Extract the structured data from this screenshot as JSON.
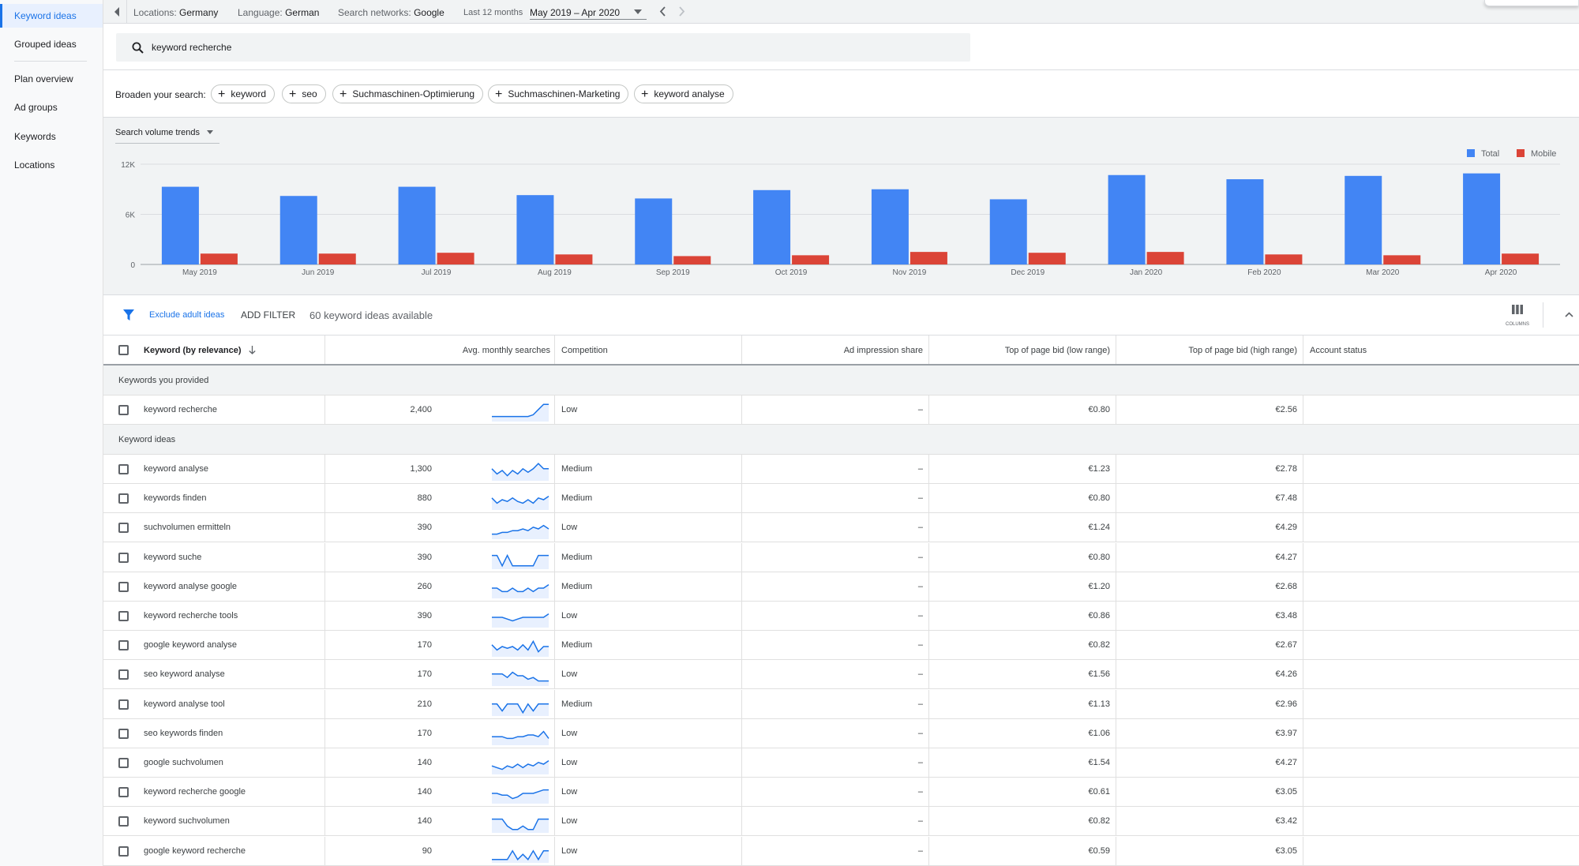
{
  "sidebar": {
    "items": [
      {
        "label": "Keyword ideas",
        "active": true
      },
      {
        "label": "Grouped ideas"
      },
      {
        "label": "Plan overview"
      },
      {
        "label": "Ad groups"
      },
      {
        "label": "Keywords"
      },
      {
        "label": "Locations"
      }
    ]
  },
  "topbar": {
    "locations_label": "Locations:",
    "locations_value": "Germany",
    "language_label": "Language:",
    "language_value": "German",
    "networks_label": "Search networks:",
    "networks_value": "Google",
    "range_label": "Last 12 months",
    "range_value": "May 2019 – Apr 2020"
  },
  "search": {
    "value": "keyword recherche"
  },
  "broaden": {
    "label": "Broaden your search:",
    "chips": [
      "keyword",
      "seo",
      "Suchmaschinen-Optimierung",
      "Suchmaschinen-Marketing",
      "keyword analyse"
    ]
  },
  "trends": {
    "selector_label": "Search volume trends"
  },
  "chart_data": {
    "type": "bar",
    "categories": [
      "May 2019",
      "Jun 2019",
      "Jul 2019",
      "Aug 2019",
      "Sep 2019",
      "Oct 2019",
      "Nov 2019",
      "Dec 2019",
      "Jan 2020",
      "Feb 2020",
      "Mar 2020",
      "Apr 2020"
    ],
    "series": [
      {
        "name": "Total",
        "color": "#4285f4",
        "values": [
          9300,
          8200,
          9300,
          8300,
          7900,
          8900,
          9000,
          7800,
          10700,
          10200,
          10600,
          10900
        ]
      },
      {
        "name": "Mobile",
        "color": "#db4437",
        "values": [
          1300,
          1300,
          1400,
          1200,
          1000,
          1100,
          1500,
          1400,
          1500,
          1200,
          1100,
          1300
        ]
      }
    ],
    "yticks": [
      "12K",
      "6K",
      "0"
    ],
    "ylim": [
      0,
      12000
    ],
    "legend": "top-right"
  },
  "filterbar": {
    "exclude_label": "Exclude adult ideas",
    "add_filter_label": "ADD FILTER",
    "count_label": "60 keyword ideas available",
    "columns_label": "COLUMNS"
  },
  "table": {
    "headers": {
      "keyword": "Keyword (by relevance)",
      "searches": "Avg. monthly searches",
      "competition": "Competition",
      "impression": "Ad impression share",
      "bid_low": "Top of page bid (low range)",
      "bid_high": "Top of page bid (high range)",
      "status": "Account status"
    },
    "group_provided": "Keywords you provided",
    "group_ideas": "Keyword ideas",
    "provided": [
      {
        "keyword": "keyword recherche",
        "searches": "2,400",
        "competition": "Low",
        "impression": "–",
        "bid_low": "€0.80",
        "bid_high": "€2.56",
        "trend": [
          2,
          2,
          2,
          2,
          2,
          2,
          2,
          2,
          3,
          6,
          9,
          9
        ]
      }
    ],
    "ideas": [
      {
        "keyword": "keyword analyse",
        "searches": "1,300",
        "competition": "Medium",
        "impression": "–",
        "bid_low": "€1.23",
        "bid_high": "€2.78",
        "trend": [
          6,
          3,
          5,
          2,
          5,
          3,
          6,
          4,
          6,
          9,
          6,
          6
        ]
      },
      {
        "keyword": "keywords finden",
        "searches": "880",
        "competition": "Medium",
        "impression": "–",
        "bid_low": "€0.80",
        "bid_high": "€7.48",
        "trend": [
          6,
          3,
          5,
          4,
          6,
          4,
          3,
          5,
          3,
          6,
          5,
          7
        ]
      },
      {
        "keyword": "suchvolumen ermitteln",
        "searches": "390",
        "competition": "Low",
        "impression": "–",
        "bid_low": "€1.24",
        "bid_high": "€4.29",
        "trend": [
          2,
          2,
          3,
          3,
          4,
          4,
          5,
          4,
          6,
          5,
          7,
          5
        ]
      },
      {
        "keyword": "keyword suche",
        "searches": "390",
        "competition": "Medium",
        "impression": "–",
        "bid_low": "€0.80",
        "bid_high": "€4.27",
        "trend": [
          7,
          7,
          1,
          7,
          1,
          1,
          1,
          1,
          1,
          7,
          7,
          7
        ]
      },
      {
        "keyword": "keyword analyse google",
        "searches": "260",
        "competition": "Medium",
        "impression": "–",
        "bid_low": "€1.20",
        "bid_high": "€2.68",
        "trend": [
          5,
          5,
          3,
          3,
          5,
          3,
          3,
          5,
          3,
          5,
          5,
          7
        ]
      },
      {
        "keyword": "keyword recherche tools",
        "searches": "390",
        "competition": "Low",
        "impression": "–",
        "bid_low": "€0.86",
        "bid_high": "€3.48",
        "trend": [
          5,
          5,
          5,
          4,
          3,
          4,
          5,
          5,
          5,
          5,
          5,
          7
        ]
      },
      {
        "keyword": "google keyword analyse",
        "searches": "170",
        "competition": "Medium",
        "impression": "–",
        "bid_low": "€0.82",
        "bid_high": "€2.67",
        "trend": [
          6,
          3,
          5,
          4,
          5,
          3,
          6,
          3,
          8,
          2,
          5,
          5
        ]
      },
      {
        "keyword": "seo keyword analyse",
        "searches": "170",
        "competition": "Low",
        "impression": "–",
        "bid_low": "€1.56",
        "bid_high": "€4.26",
        "trend": [
          6,
          6,
          6,
          4,
          7,
          5,
          5,
          3,
          4,
          2,
          2,
          2
        ]
      },
      {
        "keyword": "keyword analyse tool",
        "searches": "210",
        "competition": "Medium",
        "impression": "–",
        "bid_low": "€1.13",
        "bid_high": "€2.96",
        "trend": [
          6,
          6,
          2,
          6,
          6,
          6,
          1,
          6,
          2,
          6,
          6,
          6
        ]
      },
      {
        "keyword": "seo keywords finden",
        "searches": "170",
        "competition": "Low",
        "impression": "–",
        "bid_low": "€1.06",
        "bid_high": "€3.97",
        "trend": [
          4,
          4,
          4,
          3,
          3,
          4,
          4,
          5,
          5,
          4,
          7,
          3
        ]
      },
      {
        "keyword": "google suchvolumen",
        "searches": "140",
        "competition": "Low",
        "impression": "–",
        "bid_low": "€1.54",
        "bid_high": "€4.27",
        "trend": [
          4,
          3,
          2,
          4,
          3,
          5,
          3,
          5,
          4,
          6,
          5,
          7
        ]
      },
      {
        "keyword": "keyword recherche google",
        "searches": "140",
        "competition": "Low",
        "impression": "–",
        "bid_low": "€0.61",
        "bid_high": "€3.05",
        "trend": [
          5,
          5,
          4,
          4,
          2,
          3,
          5,
          5,
          5,
          6,
          7,
          7
        ]
      },
      {
        "keyword": "keyword suchvolumen",
        "searches": "140",
        "competition": "Low",
        "impression": "–",
        "bid_low": "€0.82",
        "bid_high": "€3.42",
        "trend": [
          7,
          7,
          7,
          3,
          1,
          1,
          3,
          1,
          1,
          7,
          7,
          7
        ]
      },
      {
        "keyword": "google keyword recherche",
        "searches": "90",
        "competition": "Low",
        "impression": "–",
        "bid_low": "€0.59",
        "bid_high": "€3.05",
        "trend": [
          1,
          1,
          1,
          1,
          6,
          1,
          4,
          1,
          6,
          1,
          6,
          6
        ]
      }
    ]
  }
}
